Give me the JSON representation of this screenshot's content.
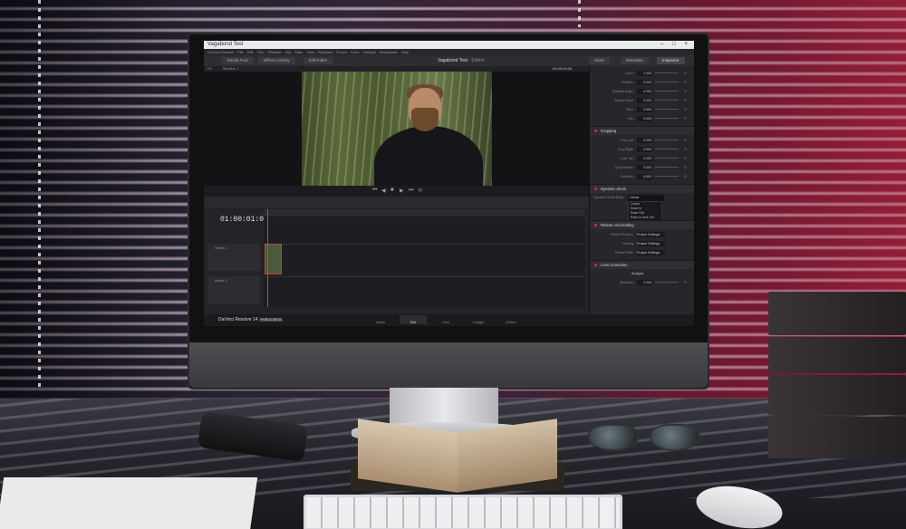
{
  "app": {
    "window_title": "Vagabond Test",
    "project_name": "Vagabond Test",
    "project_status": "Edited",
    "window_controls": [
      "–",
      "□",
      "×"
    ]
  },
  "menu": [
    "DaVinci Resolve",
    "File",
    "Edit",
    "Trim",
    "Timeline",
    "Clip",
    "Mark",
    "View",
    "Playback",
    "Fusion",
    "Color",
    "Fairlight",
    "Workspace",
    "Help"
  ],
  "toolbar": {
    "left": [
      "Media Pool",
      "Effects Library",
      "Edit Index"
    ],
    "right": [
      "Mixer",
      "Metadata",
      "Inspector"
    ]
  },
  "viewer": {
    "header_left": "Fit",
    "header_mid": "Timeline 1",
    "timecode": "01:00:01:04",
    "transport": [
      "⏮",
      "◀",
      "■",
      "▶",
      "⏭",
      "⟲"
    ]
  },
  "timeline": {
    "timecode": "01:00:01:04",
    "tracks": [
      {
        "name": "Video 1",
        "type": "video"
      },
      {
        "name": "Audio 1",
        "type": "audio"
      }
    ]
  },
  "inspector": {
    "transform_rows": [
      {
        "label": "Zoom",
        "value": "1.000",
        "value2": "1.000"
      },
      {
        "label": "Position",
        "value": "0.000",
        "value2": "0.000"
      },
      {
        "label": "Rotation Angle",
        "value": "0.000"
      },
      {
        "label": "Anchor Point",
        "value": "0.000",
        "value2": "0.000"
      },
      {
        "label": "Pitch",
        "value": "0.000"
      },
      {
        "label": "Yaw",
        "value": "0.000"
      }
    ],
    "cropping": {
      "title": "Cropping",
      "rows": [
        {
          "label": "Crop Left",
          "value": "0.000"
        },
        {
          "label": "Crop Right",
          "value": "0.000"
        },
        {
          "label": "Crop Top",
          "value": "0.000"
        },
        {
          "label": "Crop Bottom",
          "value": "0.000"
        },
        {
          "label": "Softness",
          "value": "0.000"
        }
      ]
    },
    "dynamic_zoom": {
      "title": "Dynamic Zoom",
      "label": "Dynamic Zoom Ease",
      "selected": "Linear",
      "options": [
        "Linear",
        "Ease In",
        "Ease Out",
        "Ease In and Out"
      ]
    },
    "retime": {
      "title": "Retime And Scaling",
      "rows": [
        {
          "label": "Retime Process",
          "value": "Project Settings"
        },
        {
          "label": "Scaling",
          "value": "Project Settings"
        },
        {
          "label": "Resize Filter",
          "value": "Project Settings"
        }
      ]
    },
    "lens": {
      "title": "Lens Correction",
      "button": "Analyze",
      "row": {
        "label": "Distortion",
        "value": "0.000"
      }
    }
  },
  "bottom": {
    "brand": "DaVinci Resolve 14",
    "badge": "PUBLIC BETA",
    "pages": [
      "Media",
      "Edit",
      "Color",
      "Fairlight",
      "Deliver"
    ],
    "active_page": "Edit"
  },
  "colors": {
    "accent_red": "#cc3333",
    "ui_bg": "#1e1e22",
    "blind_light": "#f2dfe8"
  }
}
